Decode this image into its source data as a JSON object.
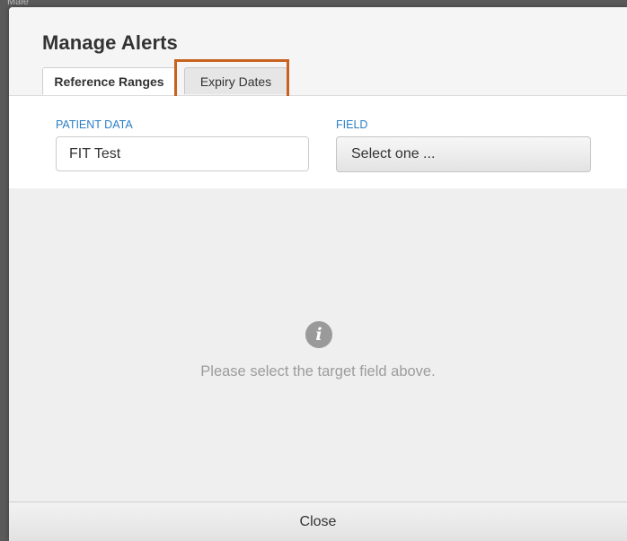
{
  "backdrop": {
    "partial_text": "Male"
  },
  "dialog": {
    "title": "Manage Alerts",
    "tabs": [
      {
        "label": "Reference Ranges",
        "active": true
      },
      {
        "label": "Expiry Dates",
        "active": false,
        "highlighted": true
      }
    ],
    "highlight_color": "#c8621f"
  },
  "form": {
    "patient_data": {
      "label": "PATIENT DATA",
      "value": "FIT Test"
    },
    "field": {
      "label": "FIELD",
      "selected": "Select one ..."
    },
    "label_color": "#2b7fc4"
  },
  "content": {
    "icon": "info-circle-icon",
    "message": "Please select the target field above."
  },
  "footer": {
    "close_label": "Close"
  }
}
